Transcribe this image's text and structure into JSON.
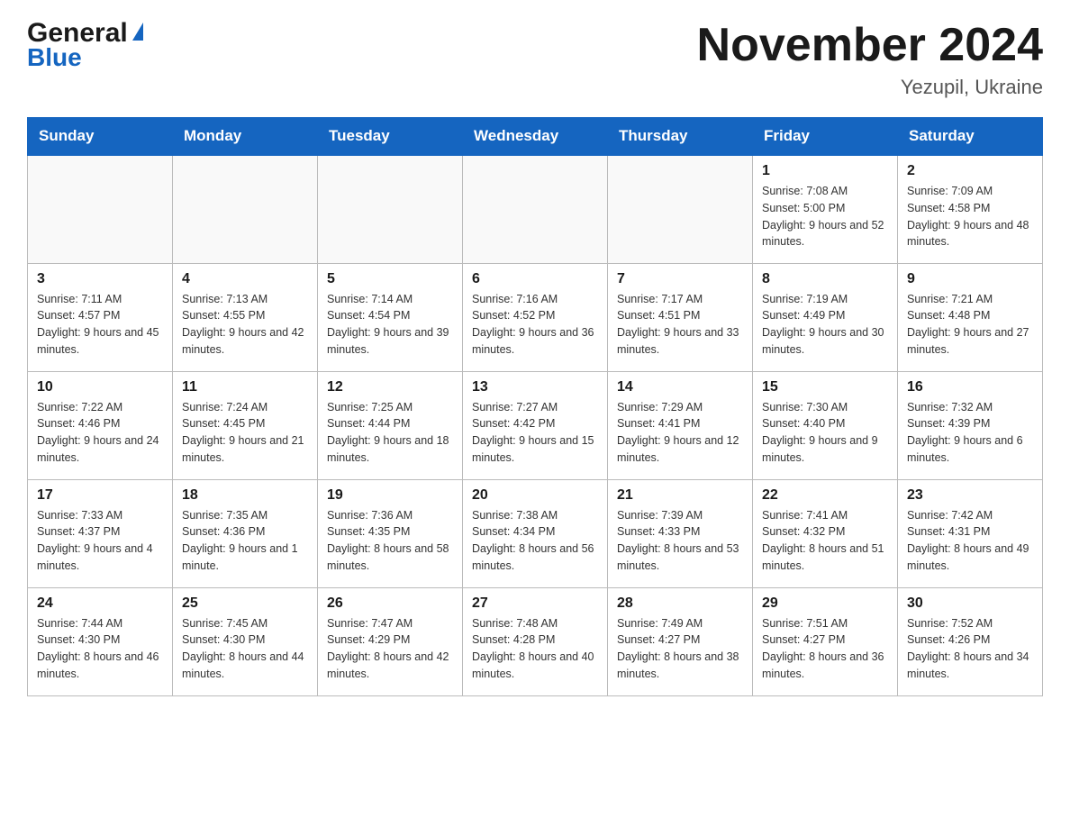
{
  "header": {
    "logo": {
      "line1": "General",
      "arrow": "▶",
      "line2": "Blue"
    },
    "title": "November 2024",
    "location": "Yezupil, Ukraine"
  },
  "weekdays": [
    "Sunday",
    "Monday",
    "Tuesday",
    "Wednesday",
    "Thursday",
    "Friday",
    "Saturday"
  ],
  "weeks": [
    [
      {
        "day": "",
        "info": ""
      },
      {
        "day": "",
        "info": ""
      },
      {
        "day": "",
        "info": ""
      },
      {
        "day": "",
        "info": ""
      },
      {
        "day": "",
        "info": ""
      },
      {
        "day": "1",
        "info": "Sunrise: 7:08 AM\nSunset: 5:00 PM\nDaylight: 9 hours and 52 minutes."
      },
      {
        "day": "2",
        "info": "Sunrise: 7:09 AM\nSunset: 4:58 PM\nDaylight: 9 hours and 48 minutes."
      }
    ],
    [
      {
        "day": "3",
        "info": "Sunrise: 7:11 AM\nSunset: 4:57 PM\nDaylight: 9 hours and 45 minutes."
      },
      {
        "day": "4",
        "info": "Sunrise: 7:13 AM\nSunset: 4:55 PM\nDaylight: 9 hours and 42 minutes."
      },
      {
        "day": "5",
        "info": "Sunrise: 7:14 AM\nSunset: 4:54 PM\nDaylight: 9 hours and 39 minutes."
      },
      {
        "day": "6",
        "info": "Sunrise: 7:16 AM\nSunset: 4:52 PM\nDaylight: 9 hours and 36 minutes."
      },
      {
        "day": "7",
        "info": "Sunrise: 7:17 AM\nSunset: 4:51 PM\nDaylight: 9 hours and 33 minutes."
      },
      {
        "day": "8",
        "info": "Sunrise: 7:19 AM\nSunset: 4:49 PM\nDaylight: 9 hours and 30 minutes."
      },
      {
        "day": "9",
        "info": "Sunrise: 7:21 AM\nSunset: 4:48 PM\nDaylight: 9 hours and 27 minutes."
      }
    ],
    [
      {
        "day": "10",
        "info": "Sunrise: 7:22 AM\nSunset: 4:46 PM\nDaylight: 9 hours and 24 minutes."
      },
      {
        "day": "11",
        "info": "Sunrise: 7:24 AM\nSunset: 4:45 PM\nDaylight: 9 hours and 21 minutes."
      },
      {
        "day": "12",
        "info": "Sunrise: 7:25 AM\nSunset: 4:44 PM\nDaylight: 9 hours and 18 minutes."
      },
      {
        "day": "13",
        "info": "Sunrise: 7:27 AM\nSunset: 4:42 PM\nDaylight: 9 hours and 15 minutes."
      },
      {
        "day": "14",
        "info": "Sunrise: 7:29 AM\nSunset: 4:41 PM\nDaylight: 9 hours and 12 minutes."
      },
      {
        "day": "15",
        "info": "Sunrise: 7:30 AM\nSunset: 4:40 PM\nDaylight: 9 hours and 9 minutes."
      },
      {
        "day": "16",
        "info": "Sunrise: 7:32 AM\nSunset: 4:39 PM\nDaylight: 9 hours and 6 minutes."
      }
    ],
    [
      {
        "day": "17",
        "info": "Sunrise: 7:33 AM\nSunset: 4:37 PM\nDaylight: 9 hours and 4 minutes."
      },
      {
        "day": "18",
        "info": "Sunrise: 7:35 AM\nSunset: 4:36 PM\nDaylight: 9 hours and 1 minute."
      },
      {
        "day": "19",
        "info": "Sunrise: 7:36 AM\nSunset: 4:35 PM\nDaylight: 8 hours and 58 minutes."
      },
      {
        "day": "20",
        "info": "Sunrise: 7:38 AM\nSunset: 4:34 PM\nDaylight: 8 hours and 56 minutes."
      },
      {
        "day": "21",
        "info": "Sunrise: 7:39 AM\nSunset: 4:33 PM\nDaylight: 8 hours and 53 minutes."
      },
      {
        "day": "22",
        "info": "Sunrise: 7:41 AM\nSunset: 4:32 PM\nDaylight: 8 hours and 51 minutes."
      },
      {
        "day": "23",
        "info": "Sunrise: 7:42 AM\nSunset: 4:31 PM\nDaylight: 8 hours and 49 minutes."
      }
    ],
    [
      {
        "day": "24",
        "info": "Sunrise: 7:44 AM\nSunset: 4:30 PM\nDaylight: 8 hours and 46 minutes."
      },
      {
        "day": "25",
        "info": "Sunrise: 7:45 AM\nSunset: 4:30 PM\nDaylight: 8 hours and 44 minutes."
      },
      {
        "day": "26",
        "info": "Sunrise: 7:47 AM\nSunset: 4:29 PM\nDaylight: 8 hours and 42 minutes."
      },
      {
        "day": "27",
        "info": "Sunrise: 7:48 AM\nSunset: 4:28 PM\nDaylight: 8 hours and 40 minutes."
      },
      {
        "day": "28",
        "info": "Sunrise: 7:49 AM\nSunset: 4:27 PM\nDaylight: 8 hours and 38 minutes."
      },
      {
        "day": "29",
        "info": "Sunrise: 7:51 AM\nSunset: 4:27 PM\nDaylight: 8 hours and 36 minutes."
      },
      {
        "day": "30",
        "info": "Sunrise: 7:52 AM\nSunset: 4:26 PM\nDaylight: 8 hours and 34 minutes."
      }
    ]
  ]
}
